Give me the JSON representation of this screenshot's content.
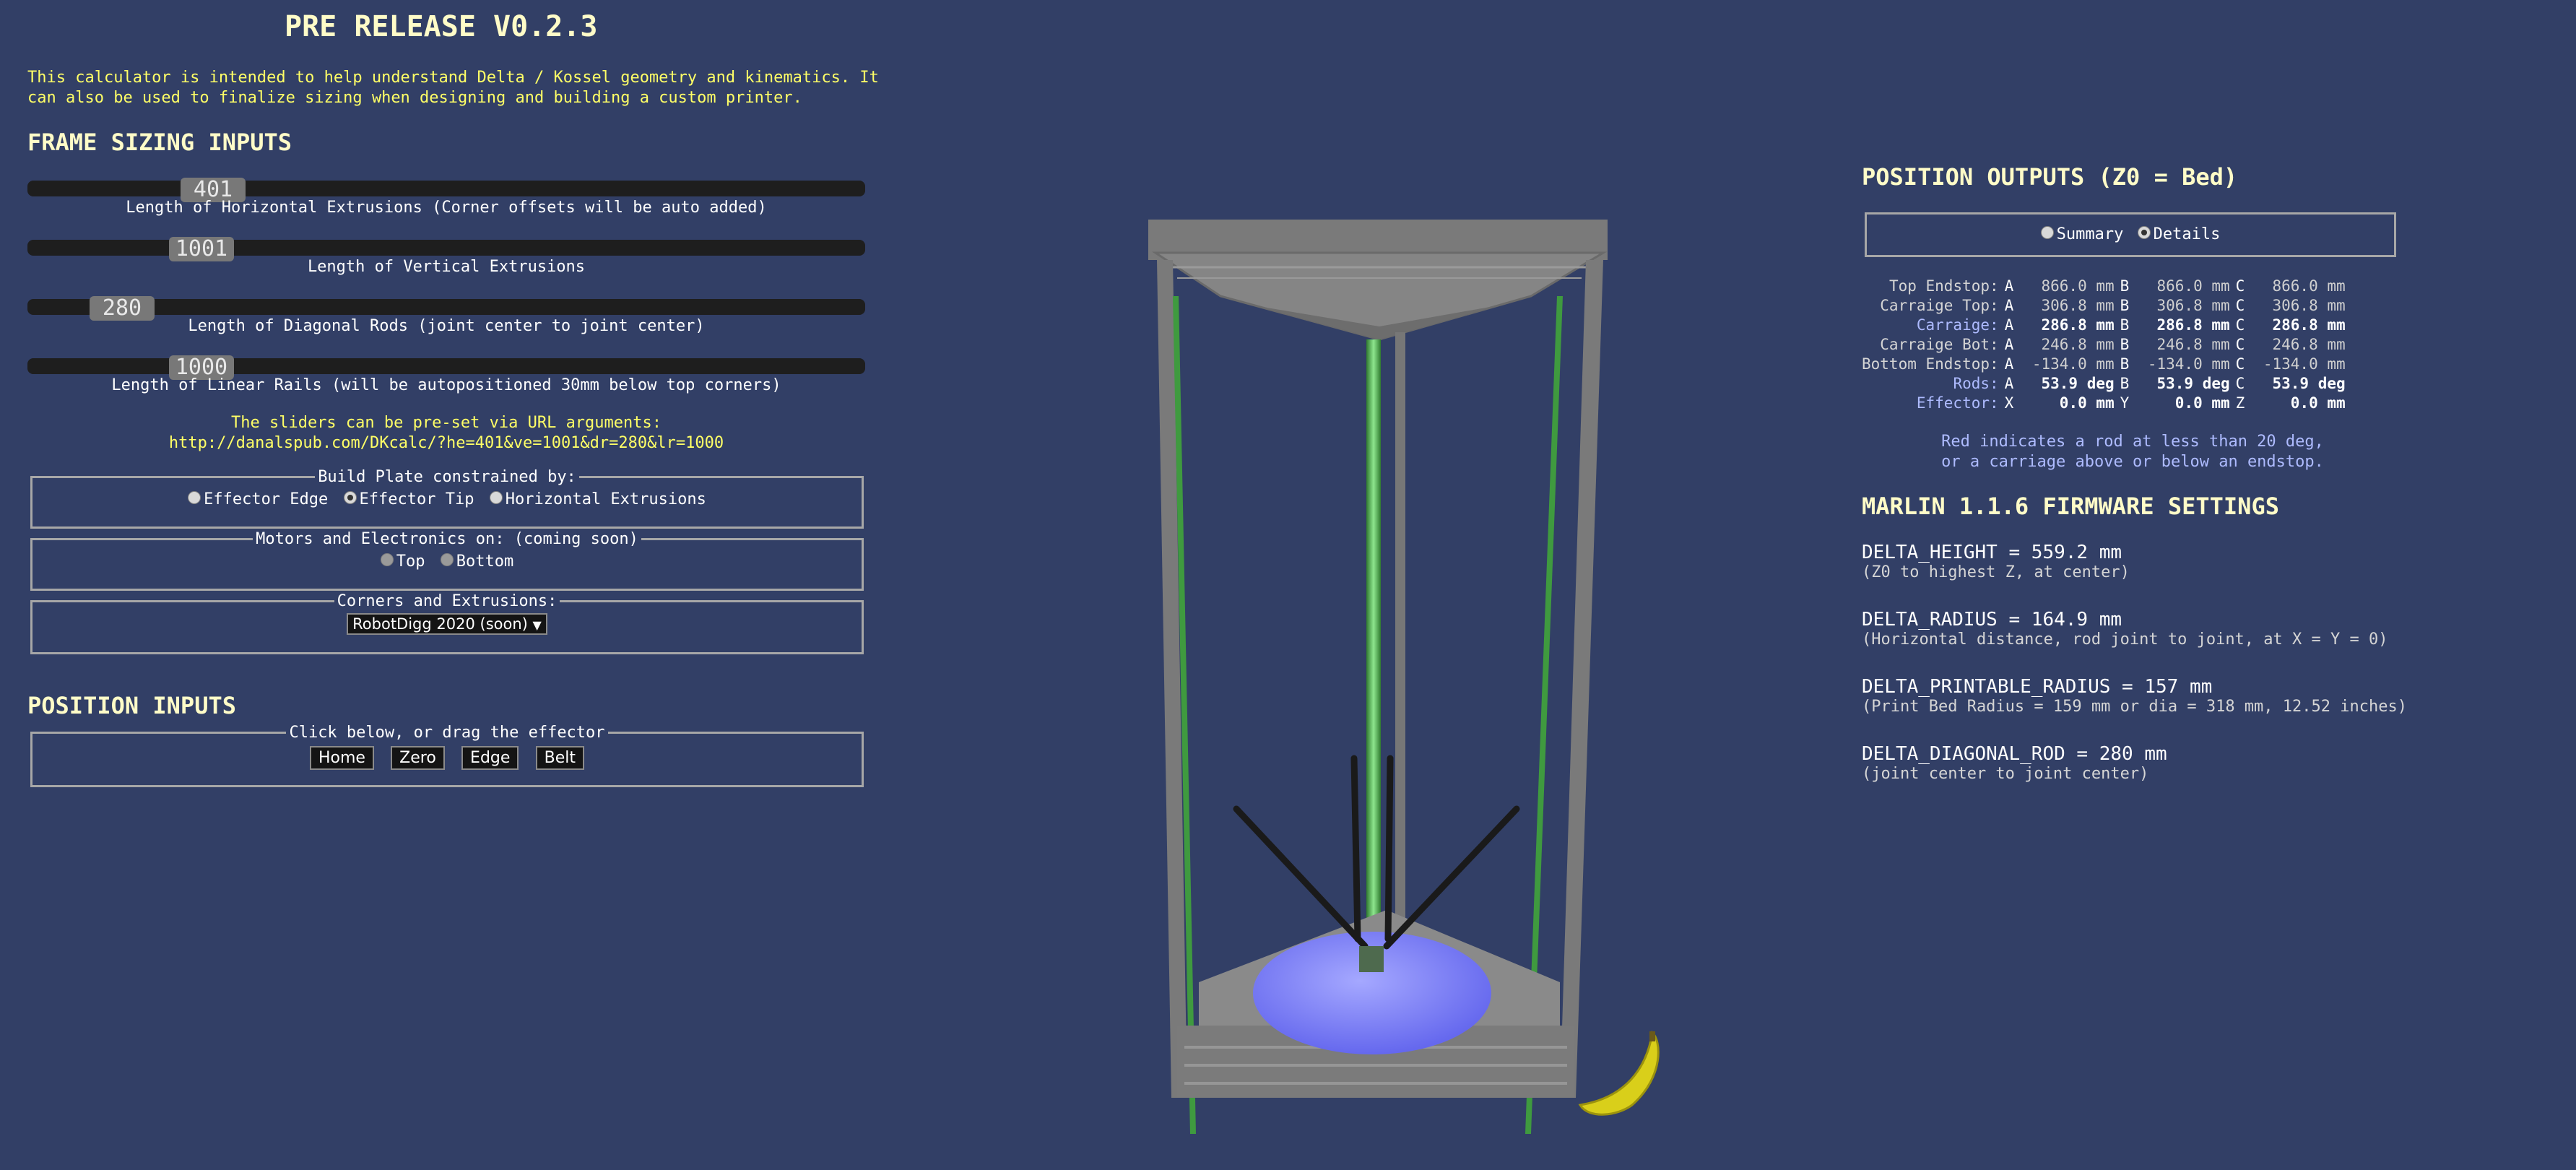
{
  "header": {
    "title": "PRE RELEASE V0.2.3",
    "intro_line1": "This calculator is intended to help understand Delta / Kossel geometry and kinematics. It",
    "intro_line2": "can also be used to finalize sizing when designing and building a custom printer."
  },
  "frame_sizing": {
    "heading": "FRAME SIZING INPUTS",
    "sliders": [
      {
        "value": "401",
        "label": "Length of Horizontal Extrusions (Corner offsets will be auto added)"
      },
      {
        "value": "1001",
        "label": "Length of Vertical Extrusions"
      },
      {
        "value": "280",
        "label": "Length of Diagonal Rods (joint center to joint center)"
      },
      {
        "value": "1000",
        "label": "Length of Linear Rails (will be autopositioned 30mm below top corners)"
      }
    ],
    "url_note": "The sliders can be pre-set via URL arguments:",
    "url": "http://danalspub.com/DKcalc/?he=401&ve=1001&dr=280&lr=1000"
  },
  "build_plate": {
    "legend": "Build Plate constrained by:",
    "options": [
      "Effector Edge",
      "Effector Tip",
      "Horizontal Extrusions"
    ],
    "selected": "Effector Tip"
  },
  "motors": {
    "legend": "Motors and Electronics on: (coming soon)",
    "options": [
      "Top",
      "Bottom"
    ]
  },
  "corners": {
    "legend": "Corners and Extrusions:",
    "selected": "RobotDigg 2020 (soon)"
  },
  "position_inputs": {
    "heading": "POSITION INPUTS",
    "legend": "Click below, or drag the effector",
    "buttons": [
      "Home",
      "Zero",
      "Edge",
      "Belt"
    ]
  },
  "position_outputs": {
    "heading": "POSITION OUTPUTS (Z0 = Bed)",
    "view_options": [
      "Summary",
      "Details"
    ],
    "selected_view": "Details",
    "rows": [
      {
        "label": "Top Endstop:",
        "axes": [
          "A",
          "B",
          "C"
        ],
        "values": [
          "866.0 mm",
          "866.0 mm",
          "866.0 mm"
        ],
        "blue": false,
        "bold": false
      },
      {
        "label": "Carraige Top:",
        "axes": [
          "A",
          "B",
          "C"
        ],
        "values": [
          "306.8 mm",
          "306.8 mm",
          "306.8 mm"
        ],
        "blue": false,
        "bold": false
      },
      {
        "label": "Carraige:",
        "axes": [
          "A",
          "B",
          "C"
        ],
        "values": [
          "286.8 mm",
          "286.8 mm",
          "286.8 mm"
        ],
        "blue": true,
        "bold": true
      },
      {
        "label": "Carraige Bot:",
        "axes": [
          "A",
          "B",
          "C"
        ],
        "values": [
          "246.8 mm",
          "246.8 mm",
          "246.8 mm"
        ],
        "blue": false,
        "bold": false
      },
      {
        "label": "Bottom Endstop:",
        "axes": [
          "A",
          "B",
          "C"
        ],
        "values": [
          "-134.0 mm",
          "-134.0 mm",
          "-134.0 mm"
        ],
        "blue": false,
        "bold": false
      },
      {
        "label": "Rods:",
        "axes": [
          "A",
          "B",
          "C"
        ],
        "values": [
          "53.9 deg",
          "53.9 deg",
          "53.9 deg"
        ],
        "blue": true,
        "bold": true
      },
      {
        "label": "Effector:",
        "axes": [
          "X",
          "Y",
          "Z"
        ],
        "values": [
          "0.0 mm",
          "0.0 mm",
          "0.0 mm"
        ],
        "blue": true,
        "bold": true
      }
    ],
    "note_line1": "Red indicates a rod at less than 20 deg,",
    "note_line2": "or a carriage above or below an endstop."
  },
  "firmware": {
    "heading": "MARLIN 1.1.6 FIRMWARE SETTINGS",
    "settings": [
      {
        "main": "DELTA_HEIGHT = 559.2 mm",
        "note": "(Z0 to highest Z, at center)"
      },
      {
        "main": "DELTA_RADIUS = 164.9 mm",
        "note": "(Horizontal distance, rod joint to joint, at X = Y = 0)"
      },
      {
        "main": "DELTA_PRINTABLE_RADIUS = 157 mm",
        "note": "(Print Bed Radius = 159 mm or dia = 318 mm, 12.52 inches)"
      },
      {
        "main": "DELTA_DIAGONAL_ROD = 280 mm",
        "note": "(joint center to joint center)"
      }
    ]
  },
  "colors": {
    "background": "#323f66",
    "heading": "#fffcc8",
    "accent_yellow": "#ffff66",
    "accent_blue": "#aebbff",
    "bed": "#8a8cff",
    "rail_green": "#3f9a3f"
  }
}
